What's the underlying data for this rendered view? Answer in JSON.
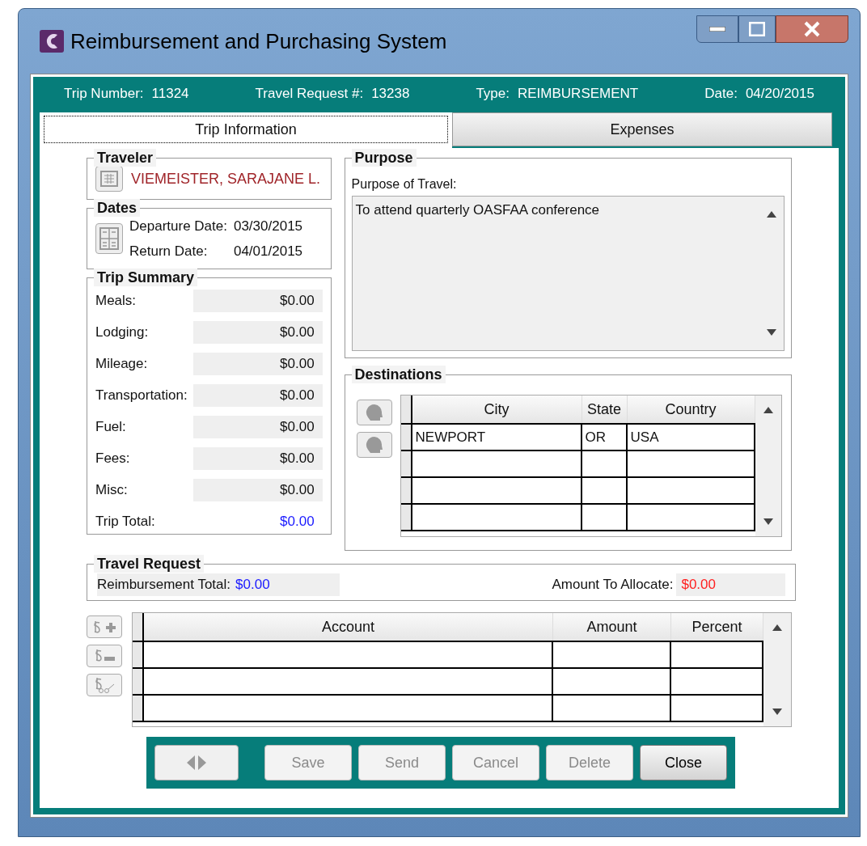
{
  "window": {
    "title": "Reimbursement and Purchasing System"
  },
  "header": [
    {
      "label": "Trip Number:",
      "value": "11324"
    },
    {
      "label": "Travel Request #:",
      "value": "13238"
    },
    {
      "label": "Type:",
      "value": "REIMBURSEMENT"
    },
    {
      "label": "Date:",
      "value": "04/20/2015"
    }
  ],
  "tabs": [
    {
      "label": "Trip Information",
      "selected": true
    },
    {
      "label": "Expenses",
      "selected": false
    }
  ],
  "traveler": {
    "title": "Traveler",
    "name": "VIEMEISTER, SARAJANE L."
  },
  "dates": {
    "title": "Dates",
    "rows": [
      {
        "label": "Departure Date:",
        "value": "03/30/2015"
      },
      {
        "label": "Return Date:",
        "value": "04/01/2015"
      }
    ]
  },
  "trip_summary": {
    "title": "Trip Summary",
    "rows": [
      {
        "label": "Meals:",
        "value": "$0.00",
        "kind": "field"
      },
      {
        "label": "Lodging:",
        "value": "$0.00",
        "kind": "field"
      },
      {
        "label": "Mileage:",
        "value": "$0.00",
        "kind": "field"
      },
      {
        "label": "Transportation:",
        "value": "$0.00",
        "kind": "field"
      },
      {
        "label": "Fuel:",
        "value": "$0.00",
        "kind": "field"
      },
      {
        "label": "Fees:",
        "value": "$0.00",
        "kind": "field"
      },
      {
        "label": "Misc:",
        "value": "$0.00",
        "kind": "field"
      },
      {
        "label": "Trip Total:",
        "value": "$0.00",
        "kind": "total"
      }
    ]
  },
  "purpose": {
    "title": "Purpose",
    "label": "Purpose of Travel:",
    "value": "To attend quarterly OASFAA conference"
  },
  "destinations": {
    "title": "Destinations",
    "columns": [
      "City",
      "State",
      "Country"
    ],
    "rows": [
      [
        "NEWPORT",
        "OR",
        "USA"
      ]
    ]
  },
  "travel_request": {
    "title": "Travel Request",
    "reimbursement_label": "Reimbursement Total:",
    "reimbursement_value": "$0.00",
    "allocate_label": "Amount To Allocate:",
    "allocate_value": "$0.00"
  },
  "accounts": {
    "columns": [
      "Account",
      "Amount",
      "Percent"
    ]
  },
  "buttons": [
    {
      "label": "Save",
      "disabled": true
    },
    {
      "label": "Send",
      "disabled": true
    },
    {
      "label": "Cancel",
      "disabled": true
    },
    {
      "label": "Delete",
      "disabled": true
    },
    {
      "label": "Close",
      "disabled": false
    }
  ]
}
